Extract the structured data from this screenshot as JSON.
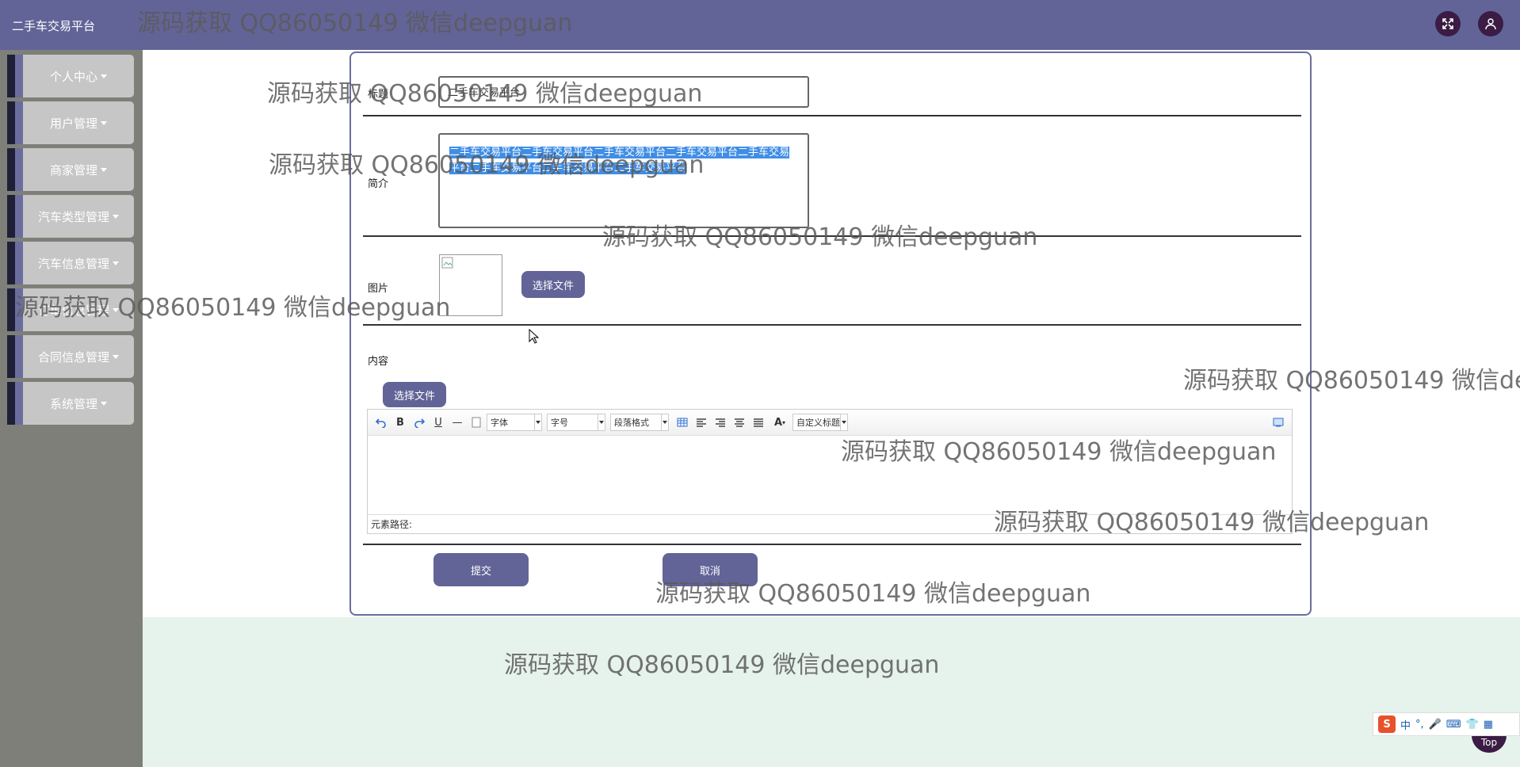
{
  "app": {
    "title": "二手车交易平台"
  },
  "sidebar": {
    "items": [
      {
        "label": "个人中心"
      },
      {
        "label": "用户管理"
      },
      {
        "label": "商家管理"
      },
      {
        "label": "汽车类型管理"
      },
      {
        "label": "汽车信息管理"
      },
      {
        "label": "订单信息管理"
      },
      {
        "label": "合同信息管理"
      },
      {
        "label": "系统管理"
      }
    ]
  },
  "form": {
    "title_label": "标题",
    "title_value": "二手车交易平台",
    "intro_label": "简介",
    "intro_value": "二手车交易平台二手车交易平台二手车交易平台二手车交易平台二手车交易平台二手车交易平台二手车交易平台二手车交易平台",
    "image_label": "图片",
    "choose_file": "选择文件",
    "content_label": "内容",
    "content_choose_file": "选择文件",
    "submit": "提交",
    "cancel": "取消"
  },
  "editor": {
    "font_family": "字体",
    "font_size": "字号",
    "paragraph": "段落格式",
    "custom_title": "自定义标题",
    "element_path": "元素路径:",
    "icons": [
      "undo-icon",
      "bold-icon",
      "redo-icon",
      "underline-icon",
      "horizontal-rule-icon",
      "paste-plain-icon",
      "table-icon",
      "align-left-icon",
      "align-right-icon",
      "align-center-icon",
      "justify-icon",
      "font-color-icon",
      "fullscreen-icon"
    ]
  },
  "watermark": "源码获取 QQ86050149 微信deepguan",
  "ime": {
    "label": "中"
  },
  "back_to_top": "Top",
  "colors": {
    "topbar": "#626497",
    "sidebar": "#7e7f78",
    "accent": "#626497",
    "page_bg": "#e6f3ec"
  }
}
